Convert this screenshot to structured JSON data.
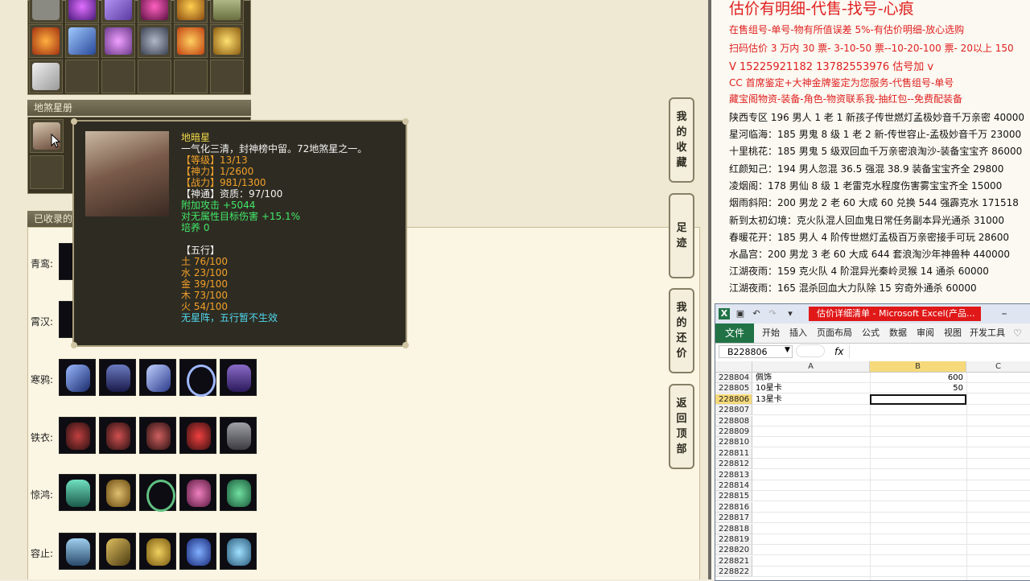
{
  "game": {
    "section_dishaxing": "地煞星册",
    "section_collected": "已收录的",
    "row_labels": [
      "青鸾:",
      "霄汉:",
      "寒鸦:",
      "铁衣:",
      "惊鸿:",
      "容止:"
    ],
    "side_buttons": [
      {
        "label": "我的收藏",
        "chars": [
          "我",
          "的",
          "收",
          "藏"
        ]
      },
      {
        "label": "足迹",
        "chars": [
          "足",
          "迹"
        ]
      },
      {
        "label": "我的还价",
        "chars": [
          "我",
          "的",
          "还",
          "价"
        ]
      },
      {
        "label": "返回顶部",
        "chars": [
          "返",
          "回",
          "顶",
          "部"
        ]
      }
    ],
    "tooltip": {
      "name": "地暗星",
      "desc": "一气化三清，封神榜中留。72地煞星之一。",
      "level": "【等级】13/13",
      "shenli": "【神力】1/2600",
      "zhanli": "【战力】981/1300",
      "shentong": "【神通】资质：97/100",
      "attack": "附加攻击 +5044",
      "damage": "对无属性目标伤害 +15.1%",
      "peiyang": "培养 0",
      "wuxing_title": "【五行】",
      "wuxing": [
        "土 76/100",
        "水 23/100",
        "金 39/100",
        "木 73/100",
        "火 54/100"
      ],
      "note": "无星阵，五行暂不生效"
    }
  },
  "doc": {
    "headline": "估价有明细-代售-找号-心痕",
    "red_lines": [
      "在售组号-单号-物有所值误差 5%-有估价明细-放心选购",
      "扫码估价 3 万内 30 票- 3-10-50 票--10-20-100 票- 20以上 150",
      "V 15225921182   13782553976   估号加 v",
      "CC 首席鉴定+大神金牌鉴定为您服务-代售组号-单号",
      "藏宝阁物资-装备-角色-物资联系我-抽红包--免费配装备"
    ],
    "listings": [
      "陕西专区 196 男人 1 老 1 新孩子传世燃灯孟极妙音千万亲密 40000",
      "星河临海：185 男鬼 8 级 1 老 2 新-传世容止-孟极妙音千万 23000",
      "十里桃花：185 男鬼 5 级双回血千万亲密浪淘沙-装备宝宝齐 86000",
      "红颜知己：194 男人忽混 36.5 强混 38.9 装备宝宝齐全 29800",
      "凌烟阁：178 男仙 8 级 1 老雷克水程度伤害雾宝宝齐全 15000",
      "烟雨斜阳：200 男龙 2 老 60 大成 60 兑换 544 强霹克水 171518",
      "新到太初幻境：克火队混人回血鬼日常任务副本异光通杀 31000",
      "春暖花开：185 男人 4 阶传世燃灯孟极百万亲密接手可玩 28600",
      "水晶宫：200 男龙 3 老 60 大成 644 套浪淘沙年神兽种 440000",
      "江湖夜雨：159 克火队 4 阶混异光秦岭灵猴 14 通杀 60000",
      "江湖夜雨：165 混杀回血大力队除 15 穷奇外通杀 60000"
    ]
  },
  "excel": {
    "title": "估价详细清单 - Microsoft Excel(产品...",
    "file_tab": "文件",
    "ribbon_tabs": [
      "开始",
      "插入",
      "页面布局",
      "公式",
      "数据",
      "审阅",
      "视图",
      "开发工具"
    ],
    "name_box": "B228806",
    "fx": "fx",
    "columns": [
      "A",
      "B",
      "C"
    ],
    "rows": [
      {
        "num": "228804",
        "a": "佩饰",
        "b": "600"
      },
      {
        "num": "228805",
        "a": "10星卡",
        "b": "50"
      },
      {
        "num": "228806",
        "a": "13星卡",
        "b": ""
      },
      {
        "num": "228807",
        "a": "",
        "b": ""
      },
      {
        "num": "228808",
        "a": "",
        "b": ""
      },
      {
        "num": "228809",
        "a": "",
        "b": ""
      },
      {
        "num": "228810",
        "a": "",
        "b": ""
      },
      {
        "num": "228811",
        "a": "",
        "b": ""
      },
      {
        "num": "228812",
        "a": "",
        "b": ""
      },
      {
        "num": "228813",
        "a": "",
        "b": ""
      },
      {
        "num": "228814",
        "a": "",
        "b": ""
      },
      {
        "num": "228815",
        "a": "",
        "b": ""
      },
      {
        "num": "228816",
        "a": "",
        "b": ""
      },
      {
        "num": "228817",
        "a": "",
        "b": ""
      },
      {
        "num": "228818",
        "a": "",
        "b": ""
      },
      {
        "num": "228819",
        "a": "",
        "b": ""
      },
      {
        "num": "228820",
        "a": "",
        "b": ""
      },
      {
        "num": "228821",
        "a": "",
        "b": ""
      },
      {
        "num": "228822",
        "a": "",
        "b": ""
      }
    ],
    "selected_row": "228806"
  },
  "colors": {
    "tooltip_gold": "#f0d84a",
    "tooltip_orange": "#f2a02a",
    "tooltip_green": "#42e86a",
    "tooltip_cyan": "#50d8f0",
    "doc_red": "#e02020",
    "excel_green": "#217346",
    "excel_title_red": "#e01818"
  }
}
